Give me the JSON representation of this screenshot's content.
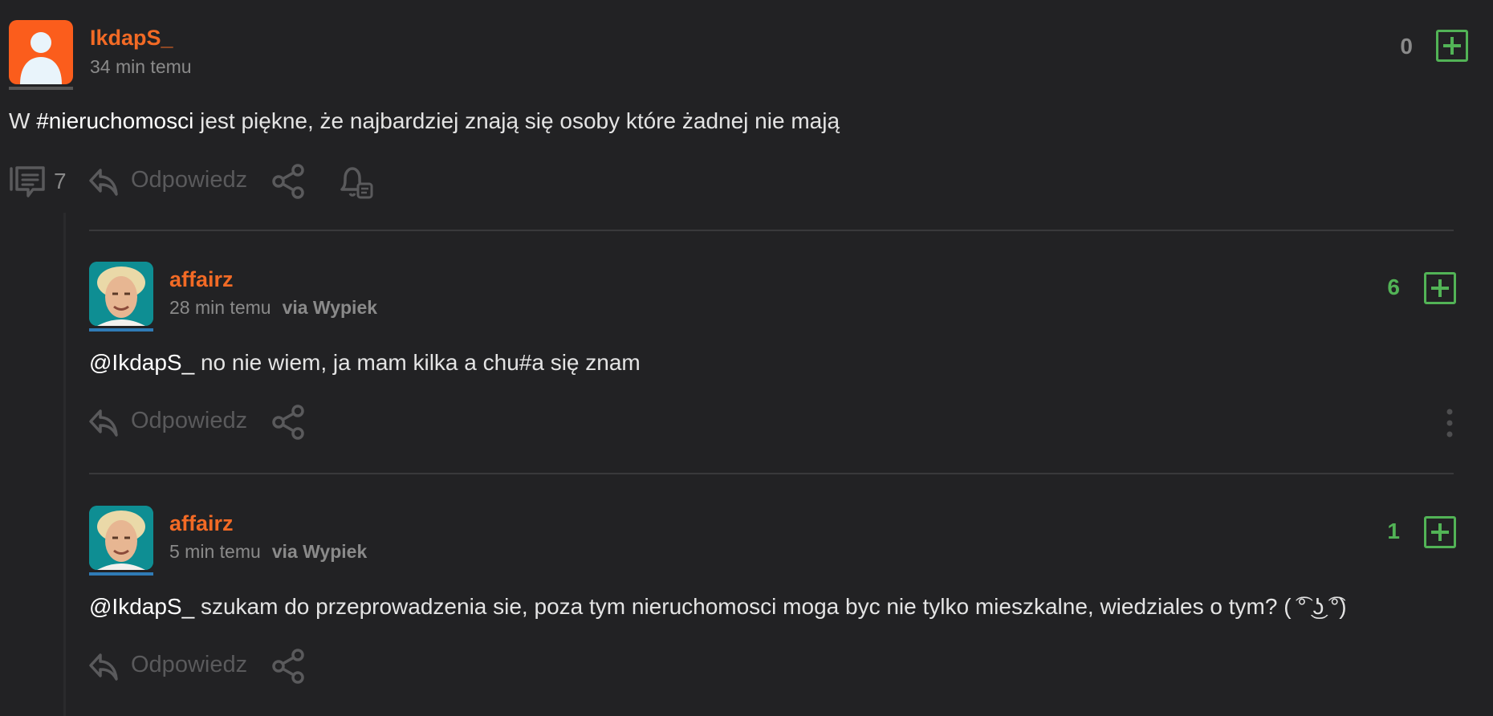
{
  "colors": {
    "background": "#222224",
    "author": "#f26a25",
    "plus_green": "#52b356",
    "score_green": "#52b356",
    "score_gray": "#8a8a8a",
    "avatar_orange": "#fb5d1c",
    "underline_blue": "#2f7bb6",
    "underline_gray": "#555555"
  },
  "post": {
    "author": "IkdapS_",
    "time": "34 min temu",
    "text_pre": "W ",
    "hashtag": "#nieruchomosci",
    "text_post": " jest piękne, że najbardziej znają się osoby które żadnej nie mają",
    "score": "0",
    "comments_count": "7",
    "reply_label": "Odpowiedz",
    "icons": {
      "avatar": "user-silhouette-icon",
      "vote": "plus-square-icon",
      "comments": "comments-icon",
      "reply": "reply-arrow-icon",
      "share": "share-icon",
      "notify": "bell-icon"
    }
  },
  "comments": [
    {
      "author": "affairz",
      "time": "28 min temu",
      "via": "via Wypiek",
      "mention": "@IkdapS_",
      "text": " no nie wiem, ja mam kilka a chu#a się znam",
      "score": "6",
      "reply_label": "Odpowiedz",
      "has_more_menu": true
    },
    {
      "author": "affairz",
      "time": "5 min temu",
      "via": "via Wypiek",
      "mention": "@IkdapS_",
      "text": " szukam do przeprowadzenia sie, poza tym nieruchomosci moga byc nie tylko mieszkalne, wiedziales o tym? ( ͡° ͜ʖ ͡°)",
      "score": "1",
      "reply_label": "Odpowiedz",
      "has_more_menu": false
    }
  ]
}
